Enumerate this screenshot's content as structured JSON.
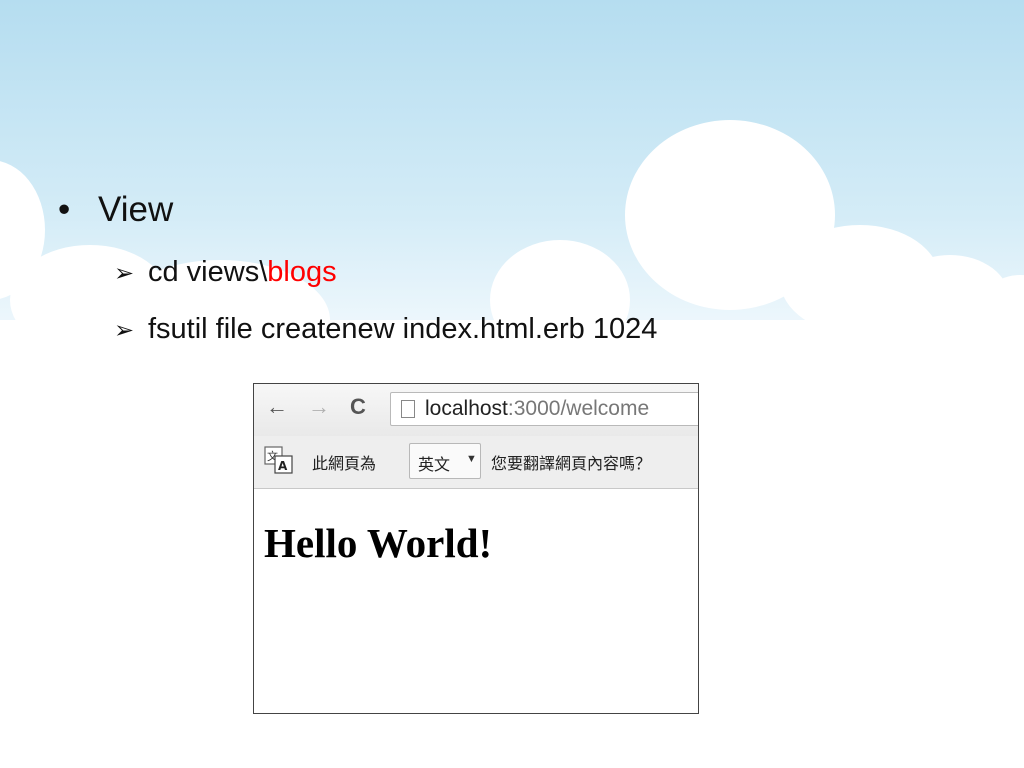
{
  "slide": {
    "bullet_main": "View",
    "items": [
      {
        "text": "cd views\\",
        "highlight": "blogs"
      },
      {
        "text": "fsutil file createnew index.html.erb 1024"
      }
    ],
    "colors": {
      "sky": "#b7dff0",
      "cloud": "#ffffff",
      "highlight": "#ff0000"
    }
  },
  "browser": {
    "nav": {
      "back_icon": "arrow-left-icon",
      "forward_icon": "arrow-right-icon",
      "reload_icon": "reload-icon"
    },
    "url_host": "localhost",
    "url_rest": ":3000/welcome",
    "translate_bar": {
      "text_before": "此網頁為",
      "language": "英文",
      "text_after": "您要翻譯網頁內容嗎？"
    },
    "page_heading": "Hello World!"
  }
}
